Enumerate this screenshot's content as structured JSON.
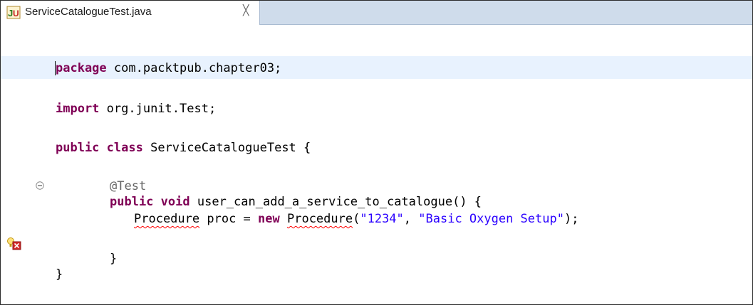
{
  "tab": {
    "title": "ServiceCatalogueTest.java",
    "close_glyph": "╳",
    "icon": "junit-file-icon"
  },
  "code": {
    "line1": {
      "kw": "package",
      "rest": " com.packtpub.chapter03;"
    },
    "line2": {
      "kw": "import",
      "rest": " org.junit.Test;"
    },
    "line3": {
      "kw1": "public",
      "kw2": "class",
      "rest": " ServiceCatalogueTest {"
    },
    "line4": {
      "annotation": "@Test"
    },
    "line5": {
      "kw1": "public",
      "kw2": "void",
      "rest": " user_can_add_a_service_to_catalogue() {"
    },
    "line6": {
      "type": "Procedure",
      "mid": " proc = ",
      "kw": "new",
      "ctor": "Procedure",
      "open": "(",
      "arg1": "\"1234\"",
      "sep": ", ",
      "arg2": "\"Basic Oxygen Setup\"",
      "close": ");"
    },
    "line7": "}",
    "line8": "}"
  },
  "gutter": {
    "fold_icon": "collapse-fold-icon",
    "marker_icon": "error-quickfix-icon"
  }
}
